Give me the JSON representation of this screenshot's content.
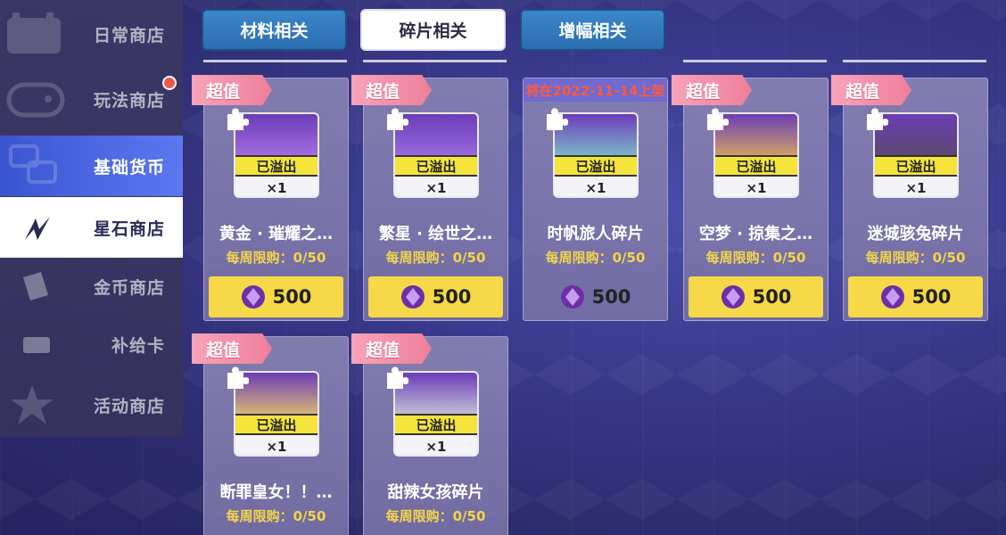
{
  "sidebar": {
    "items": [
      {
        "label": "日常商店",
        "icon": "calendar-icon"
      },
      {
        "label": "玩法商店",
        "icon": "gamepad-icon"
      },
      {
        "label": "基础货币",
        "icon": "currency-icon"
      },
      {
        "label": "星石商店",
        "icon": "star-stone-icon"
      },
      {
        "label": "金币商店",
        "icon": "coin-icon"
      },
      {
        "label": "补给卡",
        "icon": "card-icon"
      },
      {
        "label": "活动商店",
        "icon": "star-icon"
      }
    ]
  },
  "tabs": [
    {
      "label": "材料相关"
    },
    {
      "label": "碎片相关"
    },
    {
      "label": "增幅相关"
    }
  ],
  "items": [
    {
      "ribbon": "超值",
      "overflow": "已溢出",
      "qty": "×1",
      "name": "黄金 · 璀耀之…",
      "limit": "每周限购：0/50",
      "price": "500"
    },
    {
      "ribbon": "超值",
      "overflow": "已溢出",
      "qty": "×1",
      "name": "繁星 · 绘世之…",
      "limit": "每周限购：0/50",
      "price": "500"
    },
    {
      "banner": "将在2022-11-14上架",
      "overflow": "已溢出",
      "qty": "×1",
      "name": "时帆旅人碎片",
      "limit": "每周限购：0/50",
      "price": "500"
    },
    {
      "ribbon": "超值",
      "overflow": "已溢出",
      "qty": "×1",
      "name": "空梦 · 掠集之…",
      "limit": "每周限购：0/50",
      "price": "500"
    },
    {
      "ribbon": "超值",
      "overflow": "已溢出",
      "qty": "×1",
      "name": "迷城骇兔碎片",
      "limit": "每周限购：0/50",
      "price": "500"
    },
    {
      "ribbon": "超值",
      "overflow": "已溢出",
      "qty": "×1",
      "name": "断罪皇女！！…",
      "limit": "每周限购：0/50",
      "price": ""
    },
    {
      "ribbon": "超值",
      "overflow": "已溢出",
      "qty": "×1",
      "name": "甜辣女孩碎片",
      "limit": "每周限购：0/50",
      "price": ""
    }
  ],
  "colors": {
    "accent_blue": "#4a67e0",
    "price_yellow": "#f6d848",
    "ribbon_pink": "#ef7f9b",
    "limit_gold": "#f4d44a"
  }
}
